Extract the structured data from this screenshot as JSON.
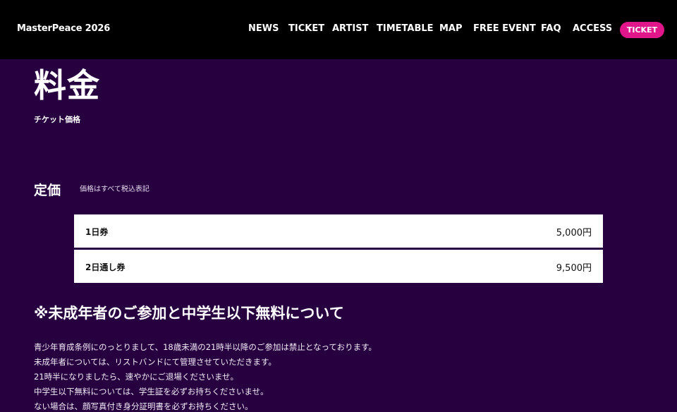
{
  "header": {
    "logo": "MasterPeace 2026",
    "nav": [
      {
        "label": "NEWS",
        "name": "nav-news"
      },
      {
        "label": "TICKET",
        "name": "nav-ticket"
      },
      {
        "label": "ARTIST",
        "name": "nav-artist"
      },
      {
        "label": "TIMETABLE",
        "name": "nav-timetable"
      },
      {
        "label": "MAP",
        "name": "nav-map"
      },
      {
        "label": "FREE EVENT",
        "name": "nav-free-event"
      },
      {
        "label": "FAQ",
        "name": "nav-faq"
      },
      {
        "label": "ACCESS",
        "name": "nav-access"
      }
    ],
    "ticket_button": "TICKET"
  },
  "page": {
    "title": "料金",
    "subtitle": "チケット価格"
  },
  "pricing": {
    "title": "定価",
    "note": "価格はすべて税込表記",
    "rows": [
      {
        "label": "1日券",
        "price": "5,000円"
      },
      {
        "label": "2日通し券",
        "price": "9,500円"
      }
    ]
  },
  "notice": {
    "title": "※未成年者のご参加と中学生以下無料について",
    "lines": [
      "青少年育成条例にのっとりまして、18歳未満の21時半以降のご参加は禁止となっております。",
      "未成年者については、リストバンドにて管理させていただきます。",
      "21時半になりましたら、速やかにご退場くださいませ。",
      "中学生以下無料については、学生証を必ずお持ちくださいませ。",
      "ない場合は、顔写真付き身分証明書を必ずお持ちください。"
    ]
  },
  "colors": {
    "background": "#270040",
    "header": "#000000",
    "accent": "#e0168a"
  }
}
